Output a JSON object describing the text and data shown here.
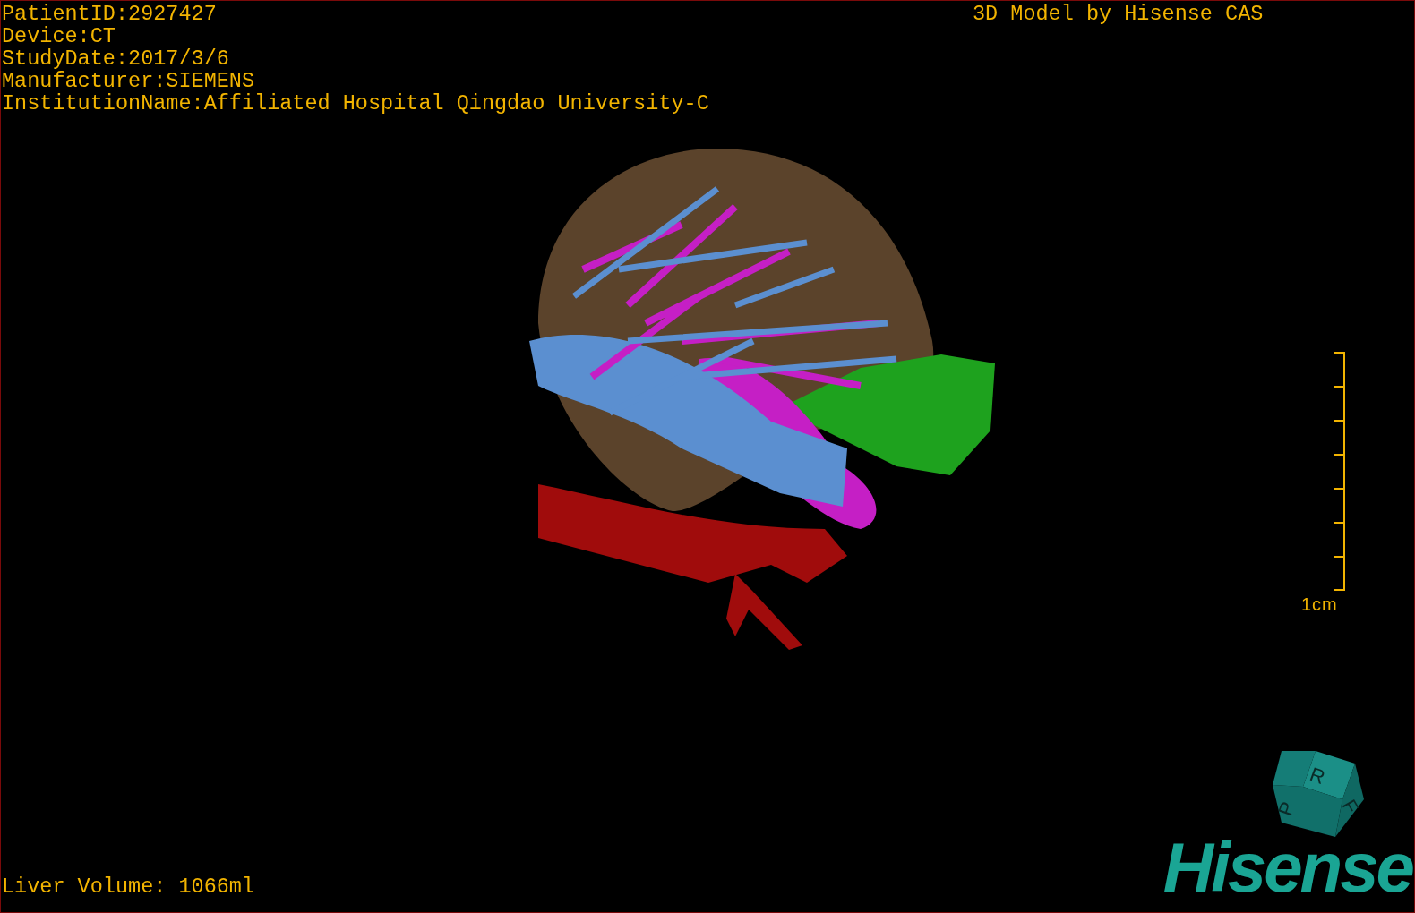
{
  "viewport": {
    "info_lines": [
      "PatientID:2927427",
      "Device:CT",
      "StudyDate:2017/3/6",
      "Manufacturer:SIEMENS",
      "InstitutionName:Affiliated Hospital Qingdao University-C"
    ],
    "title": "3D Model by Hisense CAS",
    "scale_bar": {
      "label": "1cm"
    },
    "orientation_cube": {
      "faces": [
        "R",
        "F",
        "P"
      ]
    },
    "logo": "Hisense",
    "liver_volume": "Liver Volume: 1066ml"
  }
}
